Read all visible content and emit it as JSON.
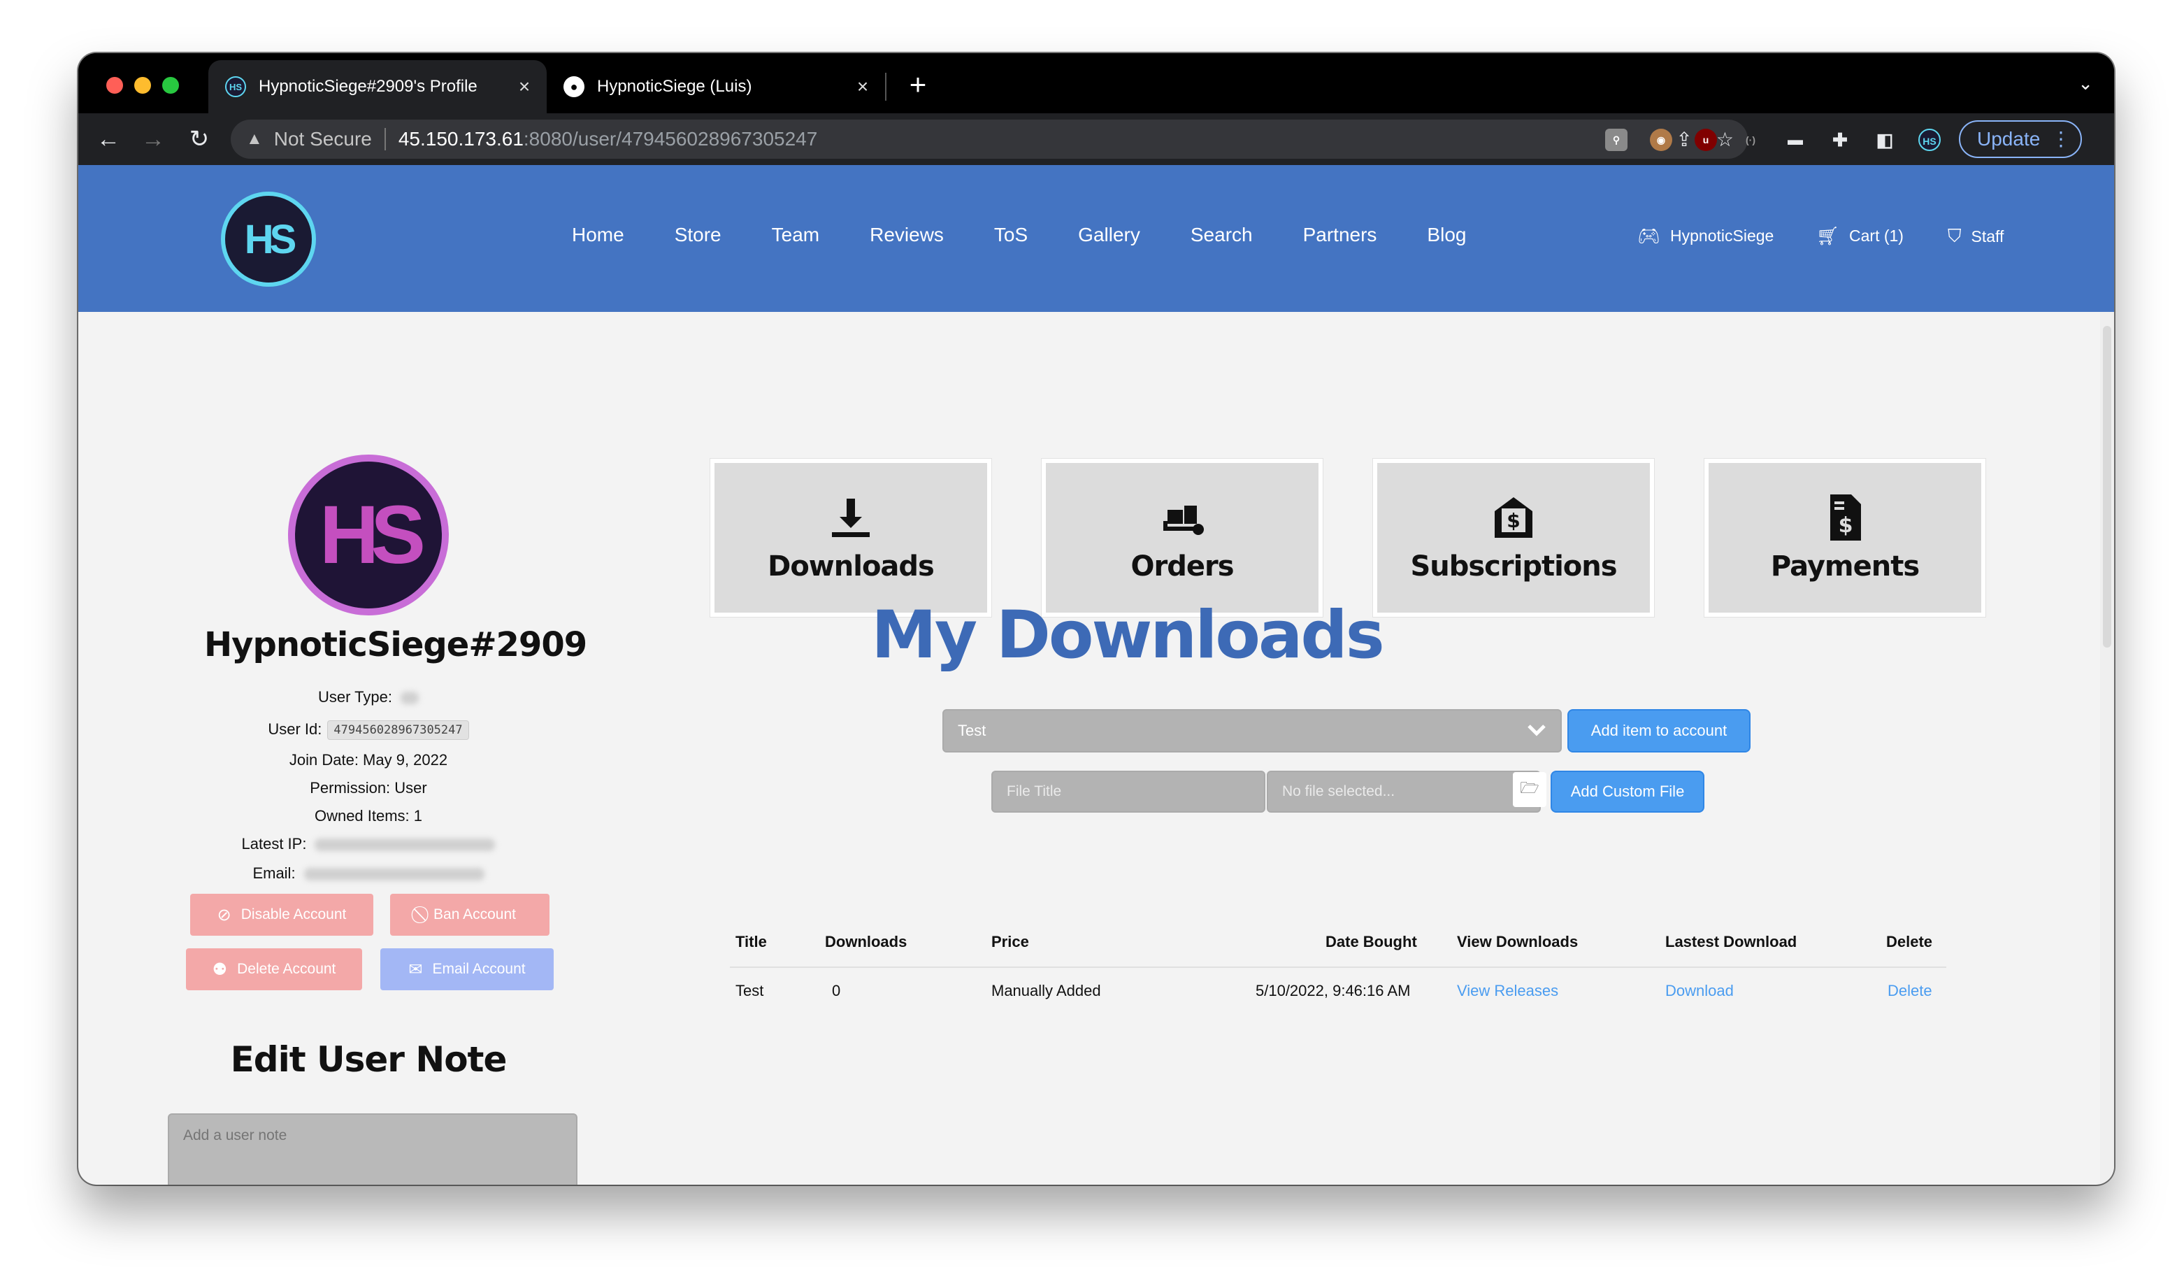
{
  "browser": {
    "tabs": [
      {
        "label": "HypnoticSiege#2909's Profile",
        "active": true
      },
      {
        "label": "HypnoticSiege (Luis)",
        "active": false
      }
    ],
    "url": {
      "security": "Not Secure",
      "host": "45.150.173.61",
      "path": ":8080/user/479456028967305247"
    },
    "update_label": "Update"
  },
  "site": {
    "logo_text": "HS",
    "nav": [
      "Home",
      "Store",
      "Team",
      "Reviews",
      "ToS",
      "Gallery",
      "Search",
      "Partners",
      "Blog"
    ],
    "nav_right": {
      "account": "HypnoticSiege",
      "cart": "Cart (1)",
      "staff": "Staff"
    }
  },
  "profile": {
    "avatar_text": "HS",
    "username": "HypnoticSiege#2909",
    "user_type_label": "User Type:",
    "user_id_label": "User Id:",
    "user_id": "479456028967305247",
    "join_date": "Join Date: May 9, 2022",
    "permission": "Permission: User",
    "owned_items": "Owned Items: 1",
    "latest_ip_label": "Latest IP:",
    "email_label": "Email:",
    "buttons": {
      "disable": "Disable Account",
      "ban": "Ban Account",
      "delete": "Delete Account",
      "email": "Email Account"
    },
    "note_title": "Edit User Note",
    "note_placeholder": "Add a user note"
  },
  "cards": {
    "downloads": "Downloads",
    "orders": "Orders",
    "subscriptions": "Subscriptions",
    "payments": "Payments"
  },
  "downloads": {
    "title": "My Downloads",
    "select_value": "Test",
    "add_item_label": "Add item to account",
    "file_title_placeholder": "File Title",
    "file_placeholder": "No file selected...",
    "add_custom_label": "Add Custom File",
    "columns": [
      "Title",
      "Downloads",
      "Price",
      "Date Bought",
      "View Downloads",
      "Lastest Download",
      "Delete"
    ],
    "rows": [
      {
        "title": "Test",
        "downloads": "0",
        "price": "Manually Added",
        "date_bought": "5/10/2022, 9:46:16 AM",
        "view_downloads": "View Releases",
        "latest_download": "Download",
        "delete": "Delete"
      }
    ]
  },
  "colors": {
    "header_blue": "#4474c2",
    "title_blue": "#3d6ab6",
    "button_blue": "#4a9cf0",
    "danger_pink": "#f3a8a8",
    "email_lavender": "#a3b7f5"
  }
}
